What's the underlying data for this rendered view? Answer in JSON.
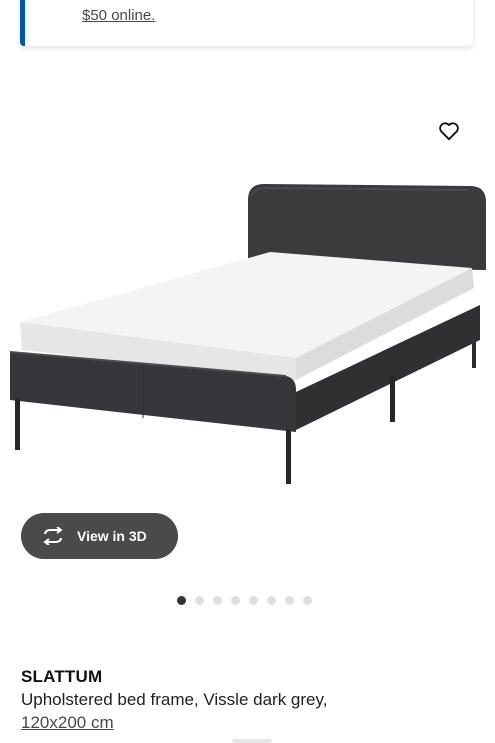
{
  "promo": {
    "link_text": "$50 online.",
    "accent_color": "#0058a3"
  },
  "product": {
    "image_alt": "SLATTUM upholstered bed frame",
    "favorite_icon": "heart-outline-icon",
    "view3d": {
      "label": "View in 3D",
      "icon": "rotate-3d-icon"
    },
    "carousel": {
      "total": 8,
      "active_index": 0
    },
    "name": "SLATTUM",
    "description": "Upholstered bed frame, Vissle dark grey,",
    "size": "120x200 cm"
  }
}
